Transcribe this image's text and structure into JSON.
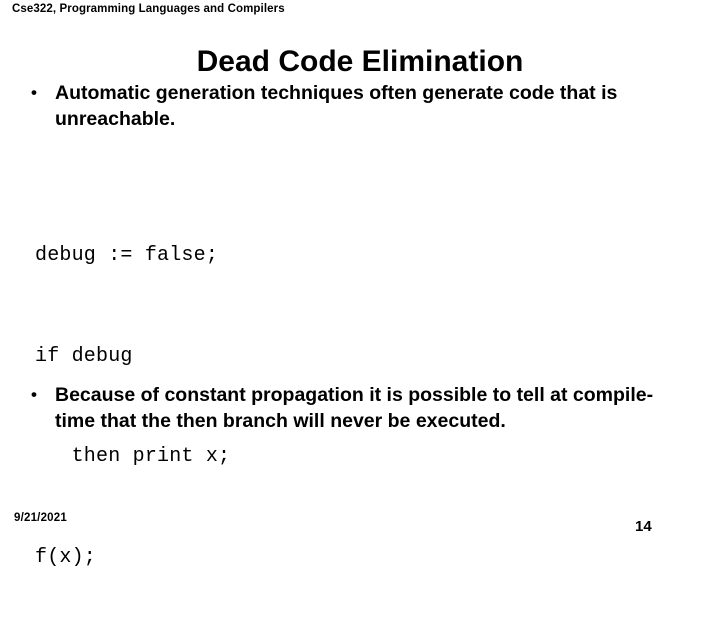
{
  "slide": {
    "header": "Cse322, Programming Languages and Compilers",
    "title": "Dead Code Elimination",
    "background_color": "#ffffff",
    "text_color": "#000000",
    "bullets": [
      {
        "marker": "•",
        "text": "Automatic generation techniques often generate code that is unreachable."
      },
      {
        "marker": "•",
        "text": "Because of constant propagation it is possible to tell at compile-time that the then branch will never be executed."
      }
    ],
    "code": {
      "lines": [
        "debug := false;",
        "if debug",
        "   then print x;",
        "f(x);"
      ]
    },
    "footer": {
      "date": "9/21/2021",
      "page_number": "14"
    }
  }
}
